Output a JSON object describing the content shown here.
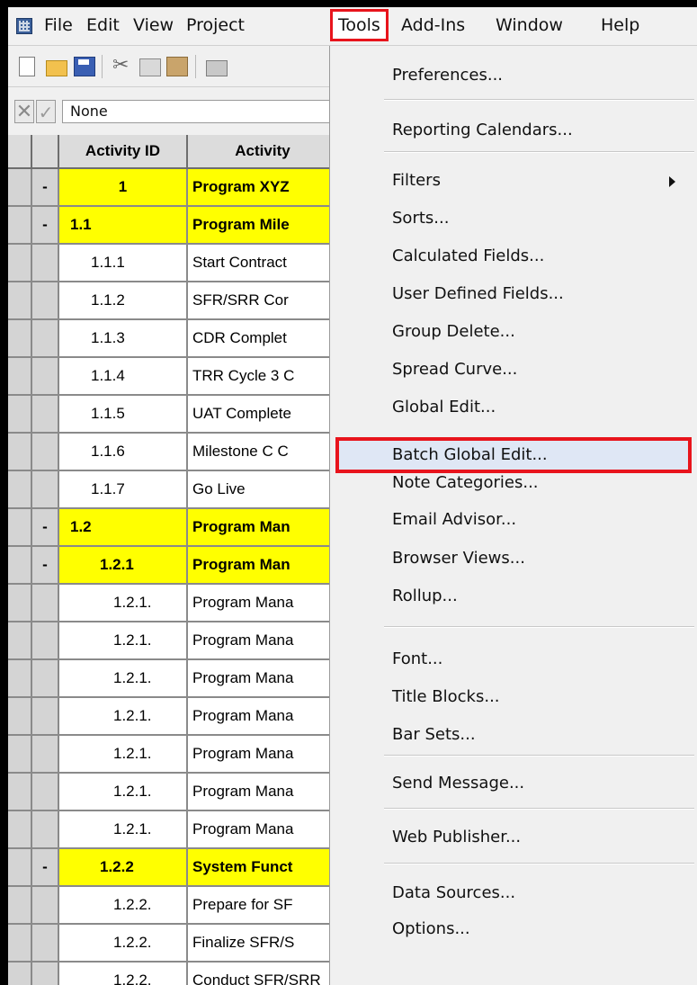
{
  "menubar": {
    "items": [
      "File",
      "Edit",
      "View",
      "Project",
      "Tools",
      "Add-Ins",
      "Window",
      "Help"
    ],
    "active": "Tools"
  },
  "editbar": {
    "cancel_glyph": "✕",
    "accept_glyph": "✓",
    "value": "None"
  },
  "grid": {
    "headers": [
      "Activity ID",
      "Activity"
    ],
    "rows": [
      {
        "exp": "-",
        "id": "1",
        "name": "Program XYZ",
        "summary": true,
        "indent": 0
      },
      {
        "exp": "-",
        "id": "1.1",
        "name": "Program Mile",
        "summary": true,
        "indent": 1
      },
      {
        "exp": "",
        "id": "1.1.1",
        "name": "Start Contract",
        "summary": false,
        "indent": 2
      },
      {
        "exp": "",
        "id": "1.1.2",
        "name": "SFR/SRR Cor",
        "summary": false,
        "indent": 2
      },
      {
        "exp": "",
        "id": "1.1.3",
        "name": "CDR Complet",
        "summary": false,
        "indent": 2
      },
      {
        "exp": "",
        "id": "1.1.4",
        "name": "TRR Cycle 3 C",
        "summary": false,
        "indent": 2
      },
      {
        "exp": "",
        "id": "1.1.5",
        "name": "UAT Complete",
        "summary": false,
        "indent": 2
      },
      {
        "exp": "",
        "id": "1.1.6",
        "name": "Milestone C C",
        "summary": false,
        "indent": 2
      },
      {
        "exp": "",
        "id": "1.1.7",
        "name": "Go Live",
        "summary": false,
        "indent": 2
      },
      {
        "exp": "-",
        "id": "1.2",
        "name": "Program Man",
        "summary": true,
        "indent": 1
      },
      {
        "exp": "-",
        "id": "1.2.1",
        "name": "Program Man",
        "summary": true,
        "indent": 3
      },
      {
        "exp": "",
        "id": "1.2.1.",
        "name": "Program Mana",
        "summary": false,
        "indent": 4
      },
      {
        "exp": "",
        "id": "1.2.1.",
        "name": "Program Mana",
        "summary": false,
        "indent": 4
      },
      {
        "exp": "",
        "id": "1.2.1.",
        "name": "Program Mana",
        "summary": false,
        "indent": 4
      },
      {
        "exp": "",
        "id": "1.2.1.",
        "name": "Program Mana",
        "summary": false,
        "indent": 4
      },
      {
        "exp": "",
        "id": "1.2.1.",
        "name": "Program Mana",
        "summary": false,
        "indent": 4
      },
      {
        "exp": "",
        "id": "1.2.1.",
        "name": "Program Mana",
        "summary": false,
        "indent": 4
      },
      {
        "exp": "",
        "id": "1.2.1.",
        "name": "Program Mana",
        "summary": false,
        "indent": 4
      },
      {
        "exp": "-",
        "id": "1.2.2",
        "name": "System Funct",
        "summary": true,
        "indent": 3
      },
      {
        "exp": "",
        "id": "1.2.2.",
        "name": "Prepare for SF",
        "summary": false,
        "indent": 4
      },
      {
        "exp": "",
        "id": "1.2.2.",
        "name": "Finalize SFR/S",
        "summary": false,
        "indent": 4
      },
      {
        "exp": "",
        "id": "1.2.2.",
        "name": "Conduct SFR/SRR",
        "summary": false,
        "indent": 4
      }
    ]
  },
  "tools_menu": {
    "groups": [
      [
        "Preferences..."
      ],
      [
        "Reporting Calendars..."
      ],
      [
        "Filters",
        "Sorts...",
        "Calculated Fields...",
        "User Defined Fields...",
        "Group Delete...",
        "Spread Curve...",
        "Global Edit...",
        "Batch Global Edit...",
        "Note Categories...",
        "Email Advisor...",
        "Browser Views...",
        "Rollup..."
      ],
      [
        "Font...",
        "Title Blocks...",
        "Bar Sets..."
      ],
      [
        "Send Message..."
      ],
      [
        "Web Publisher..."
      ],
      [
        "Data Sources...",
        "Options..."
      ]
    ],
    "submenu_item": "Filters",
    "highlighted_item": "Batch Global Edit..."
  }
}
